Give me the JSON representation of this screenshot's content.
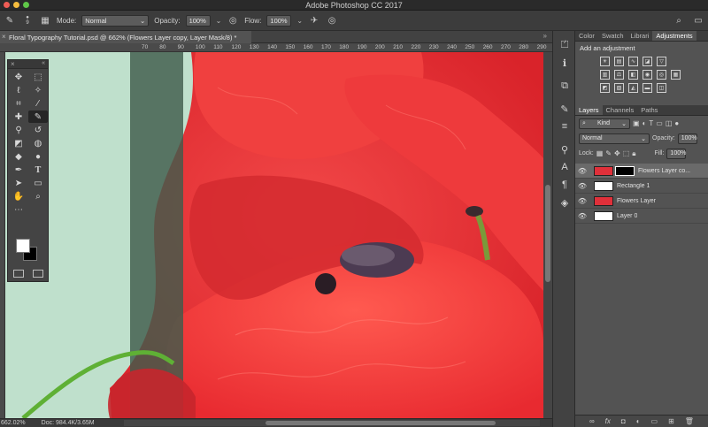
{
  "app": {
    "title": "Adobe Photoshop CC 2017"
  },
  "options_bar": {
    "brush_size": "9",
    "mode_label": "Mode:",
    "mode_value": "Normal",
    "opacity_label": "Opacity:",
    "opacity_value": "100%",
    "flow_label": "Flow:",
    "flow_value": "100%"
  },
  "document": {
    "tab_title": "Floral Typography Tutorial.psd @ 662% (Flowers Layer copy, Layer Mask/8) *",
    "ruler_ticks": [
      "70",
      "80",
      "90",
      "100",
      "110",
      "120",
      "130",
      "140",
      "150",
      "160",
      "170",
      "180",
      "190",
      "200",
      "210",
      "220",
      "230",
      "240",
      "250",
      "260",
      "270",
      "280",
      "290"
    ],
    "zoom": "662.02%",
    "doc_size": "Doc: 984.4K/3.65M"
  },
  "panels": {
    "top_tabs": [
      "Color",
      "Swatch",
      "Librari",
      "Adjustments"
    ],
    "top_active": "Adjustments",
    "adjustments_title": "Add an adjustment",
    "layers_tabs": [
      "Layers",
      "Channels",
      "Paths"
    ],
    "layers_active": "Layers",
    "filter_kind": "Kind",
    "blend_mode": "Normal",
    "opacity_label": "Opacity:",
    "opacity_value": "100%",
    "lock_label": "Lock:",
    "fill_label": "Fill:",
    "fill_value": "100%",
    "layers": [
      {
        "name": "Flowers Layer co...",
        "selected": true,
        "has_mask": true,
        "thumb": "#e0303a"
      },
      {
        "name": "Rectangle 1",
        "selected": false,
        "has_mask": false,
        "thumb": "#ffffff"
      },
      {
        "name": "Flowers Layer",
        "selected": false,
        "has_mask": false,
        "thumb": "#e0303a"
      },
      {
        "name": "Layer 0",
        "selected": false,
        "has_mask": false,
        "thumb": "#ffffff"
      }
    ],
    "bottom_icons": [
      "link-icon",
      "fx-icon",
      "mask-icon",
      "adjustment-icon",
      "folder-icon",
      "new-layer-icon",
      "trash-icon"
    ]
  },
  "colors": {
    "poppy_red": "#f03a3a",
    "mint_bg": "#bfe0cc",
    "dark_overlay": "#3f5c4c"
  }
}
